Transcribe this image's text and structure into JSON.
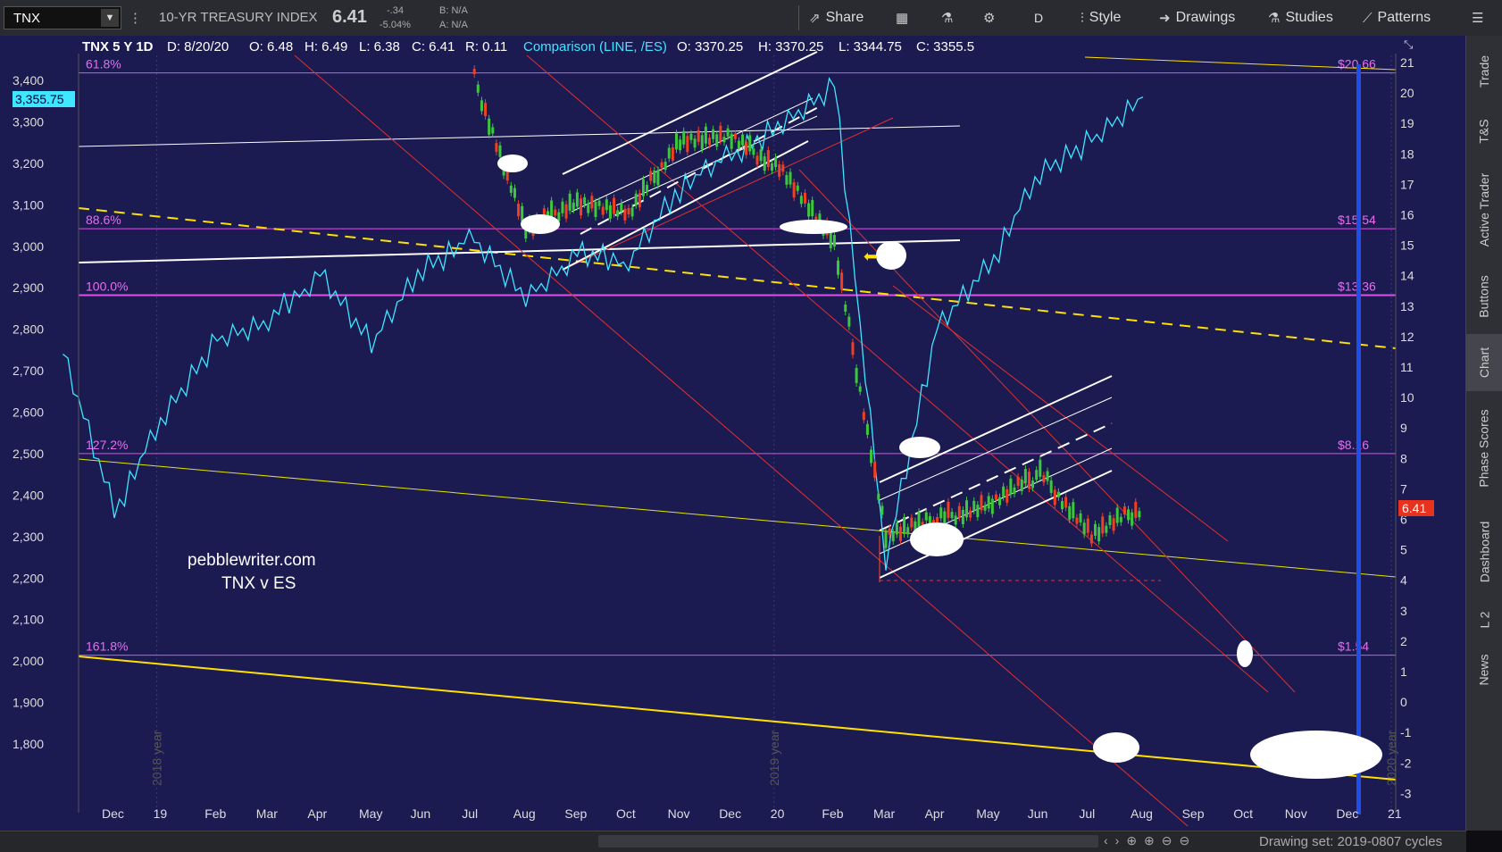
{
  "toolbar": {
    "symbol": "TNX",
    "title": "10-YR TREASURY INDEX",
    "price": "6.41",
    "change": "-.34",
    "change_pct": "-5.04%",
    "bid": "B: N/A",
    "ask": "A: N/A",
    "share": "Share",
    "aggregation": "D",
    "style": "Style",
    "drawings": "Drawings",
    "studies": "Studies",
    "patterns": "Patterns"
  },
  "chart_header": {
    "symbol_info": "TNX 5 Y 1D",
    "date": "D: 8/20/20",
    "open": "O: 6.48",
    "high": "H: 6.49",
    "low": "L: 6.38",
    "close": "C: 6.41",
    "range": "R: 0.11",
    "comparison": "Comparison (LINE, /ES)",
    "cmp_open": "O: 3370.25",
    "cmp_high": "H: 3370.25",
    "cmp_low": "L: 3344.75",
    "cmp_close": "C: 3355.5"
  },
  "annotation": {
    "line1": "pebblewriter.com",
    "line2": "TNX v ES"
  },
  "price_tag": "6.41",
  "comparison_tag": "3,355.75",
  "year_markers": [
    "2018 year",
    "2019 year",
    "2020 year"
  ],
  "fib_levels": [
    {
      "pct": "61.8%",
      "price": "$20.66",
      "tnx": 20.66
    },
    {
      "pct": "88.6%",
      "price": "$15.54",
      "tnx": 15.54
    },
    {
      "pct": "100.0%",
      "price": "$13.36",
      "tnx": 13.36
    },
    {
      "pct": "127.2%",
      "price": "$8.16",
      "tnx": 8.16
    },
    {
      "pct": "161.8%",
      "price": "$1.54",
      "tnx": 1.54
    }
  ],
  "sidebar_tabs": [
    "Trade",
    "T&S",
    "Active Trader",
    "Buttons",
    "Chart",
    "Phase Scores",
    "Dashboard",
    "L 2",
    "News"
  ],
  "status_text": "Drawing set: 2019-0807 cycles",
  "chart_data": {
    "type": "line",
    "left_axis_ticks": [
      "3,400",
      "3,300",
      "3,200",
      "3,100",
      "3,000",
      "2,900",
      "2,800",
      "2,700",
      "2,600",
      "2,500",
      "2,400",
      "2,300",
      "2,200",
      "2,100",
      "2,000",
      "1,900",
      "1,800"
    ],
    "right_axis_ticks": [
      "21",
      "20",
      "19",
      "18",
      "17",
      "16",
      "15",
      "14",
      "13",
      "12",
      "11",
      "10",
      "9",
      "8",
      "7",
      "6",
      "5",
      "4",
      "3",
      "2",
      "1",
      "0",
      "-1",
      "-2",
      "-3"
    ],
    "x_ticks": [
      "Dec",
      "19",
      "Feb",
      "Mar",
      "Apr",
      "May",
      "Jun",
      "Jul",
      "Aug",
      "Sep",
      "Oct",
      "Nov",
      "Dec",
      "20",
      "Feb",
      "Mar",
      "Apr",
      "May",
      "Jun",
      "Jul",
      "Aug",
      "Sep",
      "Oct",
      "Nov",
      "Dec",
      "21"
    ],
    "es_series": {
      "name": "/ES",
      "x": [
        "2018-11",
        "2018-12",
        "2019-01",
        "2019-02",
        "2019-03",
        "2019-04",
        "2019-05",
        "2019-06",
        "2019-07",
        "2019-08",
        "2019-09",
        "2019-10",
        "2019-11",
        "2019-12",
        "2020-01",
        "2020-02",
        "2020-03",
        "2020-04",
        "2020-05",
        "2020-06",
        "2020-07",
        "2020-08"
      ],
      "values": [
        2740,
        2360,
        2600,
        2780,
        2820,
        2930,
        2760,
        2950,
        3020,
        2880,
        2980,
        2960,
        3140,
        3220,
        3300,
        3390,
        2240,
        2800,
        2950,
        3180,
        3260,
        3360
      ]
    },
    "tnx_series": {
      "name": "TNX",
      "x": [
        "2019-07",
        "2019-08",
        "2019-09",
        "2019-10",
        "2019-11",
        "2019-12",
        "2020-01",
        "2020-02",
        "2020-03",
        "2020-04",
        "2020-05",
        "2020-06",
        "2020-07",
        "2020-08"
      ],
      "values": [
        20.5,
        15.5,
        16.5,
        16.0,
        18.5,
        18.5,
        17.5,
        15.0,
        5.5,
        6.0,
        6.5,
        7.5,
        5.5,
        6.41
      ]
    }
  }
}
